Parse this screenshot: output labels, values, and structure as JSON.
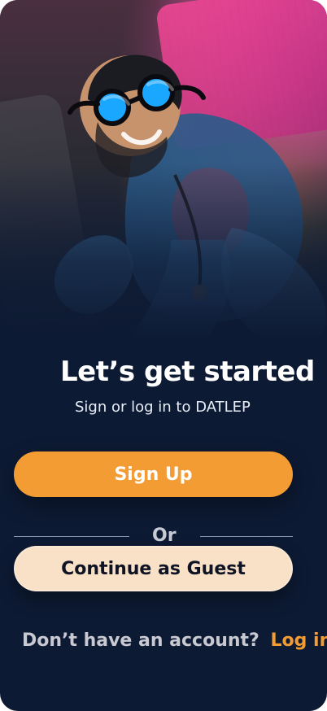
{
  "colors": {
    "background": "#0d1a33",
    "accent": "#f39c33",
    "secondary_button_bg": "#f8e1c6",
    "text_primary": "#ffffff",
    "text_muted": "#c9c9d1"
  },
  "hero": {
    "image_label": "hero-photo"
  },
  "header": {
    "title": "Let’s get started",
    "subtitle": "Sign or log in to DATLEP"
  },
  "actions": {
    "primary_label": "Sign Up",
    "divider_label": "Or",
    "secondary_label": "Continue as Guest"
  },
  "footer": {
    "prompt": "Don’t have an account?",
    "link_label": "Log in"
  }
}
